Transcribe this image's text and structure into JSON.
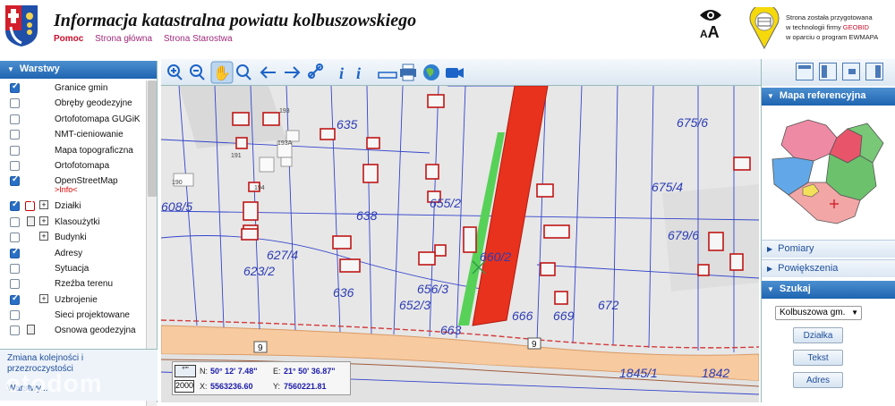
{
  "header": {
    "title": "Informacja katastralna powiatu kolbuszowskiego",
    "nav": {
      "help": "Pomoc",
      "home": "Strona główna",
      "starostwo": "Strona Starostwa"
    },
    "font_size_label": "A",
    "font_size_label_large": "A",
    "geobid_line1": "Strona została przygotowana",
    "geobid_line2_prefix": "w technologii firmy ",
    "geobid_brand": "GEOBID",
    "geobid_line3": "w oparciu o program EWMAPA"
  },
  "layers_panel": {
    "title": "Warstwy",
    "items": [
      {
        "label": "Granice gmin",
        "checked": true
      },
      {
        "label": "Obręby geodezyjne",
        "checked": false
      },
      {
        "label": "Ortofotomapa GUGiK",
        "checked": false
      },
      {
        "label": "NMT-cieniowanie",
        "checked": false
      },
      {
        "label": "Mapa topograficzna",
        "checked": false
      },
      {
        "label": "Ortofotomapa",
        "checked": false
      },
      {
        "label": "OpenStreetMap",
        "checked": true,
        "info": ">Info<"
      },
      {
        "label": "Działki",
        "checked": true
      },
      {
        "label": "Klasoużytki",
        "checked": false
      },
      {
        "label": "Budynki",
        "checked": false
      },
      {
        "label": "Adresy",
        "checked": true
      },
      {
        "label": "Sytuacja",
        "checked": false
      },
      {
        "label": "Rzeźba terenu",
        "checked": false
      },
      {
        "label": "Uzbrojenie",
        "checked": true
      },
      {
        "label": "Sieci projektowane",
        "checked": false
      },
      {
        "label": "Osnowa geodezyjna",
        "checked": false
      }
    ],
    "order_change": "Zmiana kolejności i przezroczystości",
    "order_sub": "Warstwy..."
  },
  "coords": {
    "n_label": "N:",
    "n_value": "50° 12' 7.48\"",
    "e_label": "E:",
    "e_value": "21° 50' 36.87\"",
    "x_label": "X:",
    "x_value": "5563236.60",
    "y_label": "Y:",
    "y_value": "7560221.81",
    "system": "2000",
    "deg_badge": "°'\""
  },
  "map_labels": {
    "parcels": [
      "635",
      "638",
      "636",
      "656/3",
      "652/3",
      "655/2",
      "660/2",
      "666",
      "669",
      "672",
      "675/6",
      "675/4",
      "679/6",
      "663",
      "608/5",
      "627/4",
      "623/2",
      "1845/1",
      "1842"
    ],
    "road_numbers": [
      "9",
      "9"
    ],
    "buildings": [
      "191",
      "193A",
      "193",
      "190",
      "194"
    ]
  },
  "right_panel": {
    "ref_map_title": "Mapa referencyjna",
    "pomiary": "Pomiary",
    "powiekszenia": "Powiększenia",
    "szukaj": "Szukaj",
    "gmina_selected": "Kolbuszowa gm.",
    "btn_dzialka": "Działka",
    "btn_tekst": "Tekst",
    "btn_adres": "Adres"
  },
  "watermark": "otodom",
  "colors": {
    "header_blue": "#1e64b0",
    "highlight_red": "#e8321e",
    "highlight_green": "#5fd35f",
    "road": "#f7caa0"
  }
}
